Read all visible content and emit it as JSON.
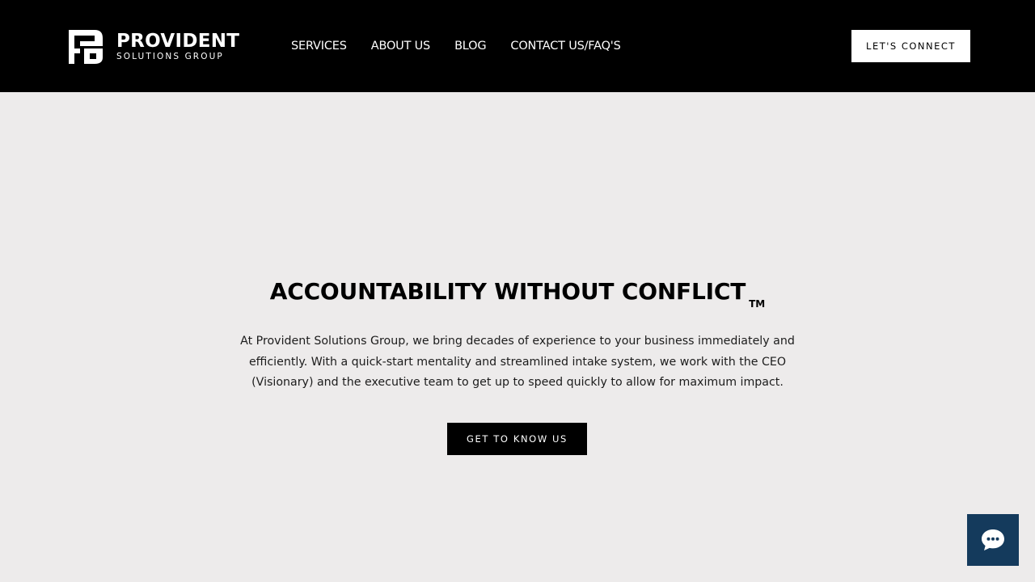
{
  "brand": {
    "name": "PROVIDENT",
    "tagline": "SOLUTIONS GROUP"
  },
  "nav": {
    "items": [
      {
        "label": "SERVICES"
      },
      {
        "label": "ABOUT US"
      },
      {
        "label": "BLOG"
      },
      {
        "label": "CONTACT US/FAQ'S"
      }
    ]
  },
  "header": {
    "cta_label": "LET'S CONNECT"
  },
  "hero": {
    "title": "ACCOUNTABILITY WITHOUT CONFLICT",
    "trademark": "TM",
    "description": "At Provident Solutions Group, we bring decades of experience to your business immediately and efficiently. With a quick-start mentality and streamlined intake system, we work with the CEO (Visionary) and the executive team to get up to speed quickly to allow for maximum impact.",
    "cta_label": "GET TO KNOW US"
  },
  "chat": {
    "icon": "chat-bubble-icon"
  },
  "colors": {
    "header_bg": "#000000",
    "page_bg": "#edebeb",
    "chat_bg": "#143a5c"
  }
}
